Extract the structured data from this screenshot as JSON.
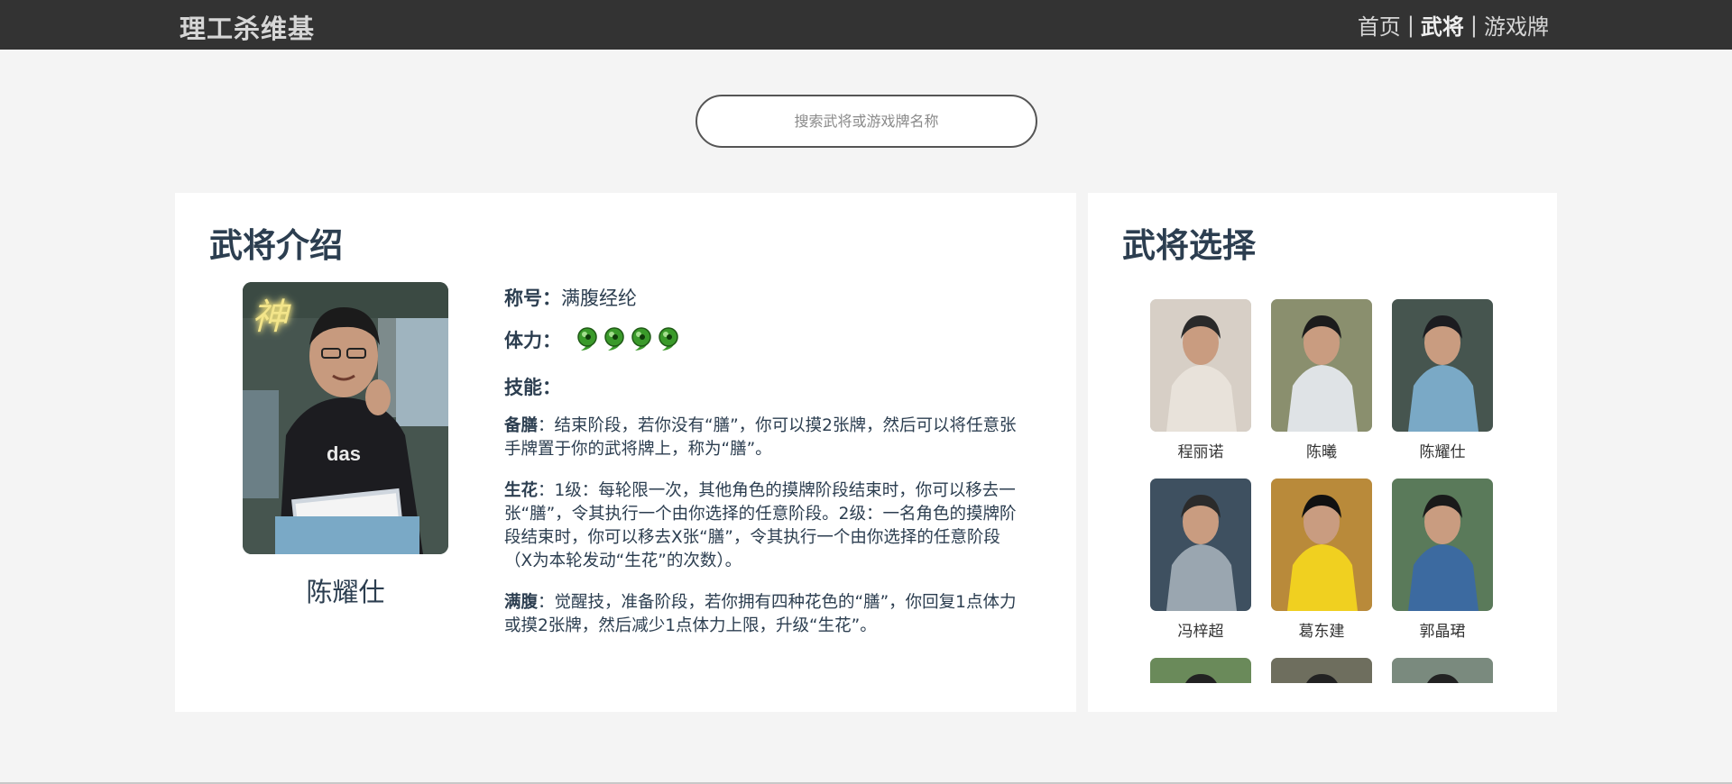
{
  "header": {
    "brand": "理工杀维基",
    "nav": [
      {
        "label": "首页",
        "active": false
      },
      {
        "label": "武将",
        "active": true
      },
      {
        "label": "游戏牌",
        "active": false
      }
    ],
    "separator": "|"
  },
  "search": {
    "placeholder": "搜索武将或游戏牌名称",
    "value": ""
  },
  "intro": {
    "title": "武将介绍",
    "name": "陈耀仕",
    "portrait_badge": "神",
    "title_label": "称号：",
    "title_value": "满腹经纶",
    "hp_label": "体力：",
    "hp": 4,
    "skills_label": "技能：",
    "skills": [
      {
        "name": "备膳",
        "text": "：结束阶段，若你没有“膳”，你可以摸2张牌，然后可以将任意张手牌置于你的武将牌上，称为“膳”。"
      },
      {
        "name": "生花",
        "text": "：1级：每轮限一次，其他角色的摸牌阶段结束时，你可以移去一张“膳”，令其执行一个由你选择的任意阶段。2级：一名角色的摸牌阶段结束时，你可以移去X张“膳”，令其执行一个由你选择的任意阶段（X为本轮发动“生花”的次数）。"
      },
      {
        "name": "满腹",
        "text": "：觉醒技，准备阶段，若你拥有四种花色的“膳”，你回复1点体力或摸2张牌，然后减少1点体力上限，升级“生花”。"
      }
    ]
  },
  "select": {
    "title": "武将选择",
    "characters": [
      {
        "name": "程丽诺"
      },
      {
        "name": "陈曦"
      },
      {
        "name": "陈耀仕"
      },
      {
        "name": "冯梓超"
      },
      {
        "name": "葛东建"
      },
      {
        "name": "郭晶珺"
      },
      {
        "name": ""
      },
      {
        "name": ""
      },
      {
        "name": ""
      }
    ]
  },
  "colors": {
    "topbar": "#333333",
    "heading": "#2c3e50",
    "hp": "#3a9a2a"
  }
}
